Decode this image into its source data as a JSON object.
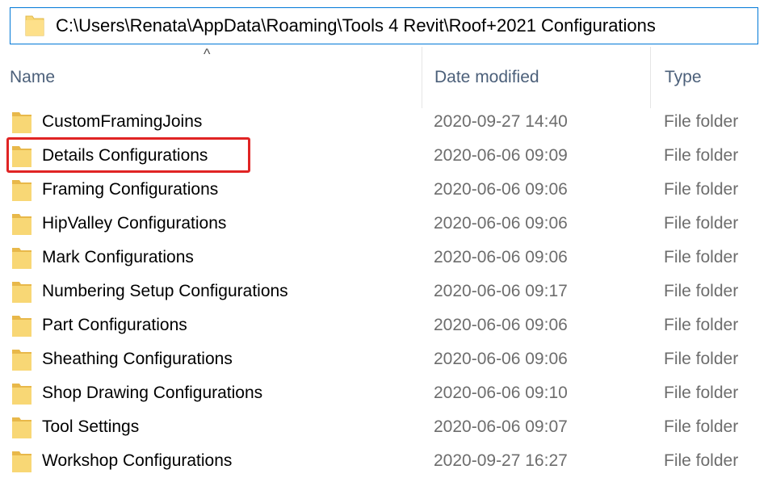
{
  "address_bar": {
    "path": "C:\\Users\\Renata\\AppData\\Roaming\\Tools 4 Revit\\Roof+2021 Configurations"
  },
  "columns": {
    "name": "Name",
    "date_modified": "Date modified",
    "type": "Type",
    "sort_indicator": "^"
  },
  "highlight_color": "#e02424",
  "folder_color": "#f8d775",
  "items": [
    {
      "name": "CustomFramingJoins",
      "date": "2020-09-27 14:40",
      "type": "File folder"
    },
    {
      "name": "Details Configurations",
      "date": "2020-06-06 09:09",
      "type": "File folder",
      "highlighted": true
    },
    {
      "name": "Framing Configurations",
      "date": "2020-06-06 09:06",
      "type": "File folder"
    },
    {
      "name": "HipValley Configurations",
      "date": "2020-06-06 09:06",
      "type": "File folder"
    },
    {
      "name": "Mark Configurations",
      "date": "2020-06-06 09:06",
      "type": "File folder"
    },
    {
      "name": "Numbering Setup Configurations",
      "date": "2020-06-06 09:17",
      "type": "File folder"
    },
    {
      "name": "Part Configurations",
      "date": "2020-06-06 09:06",
      "type": "File folder"
    },
    {
      "name": "Sheathing Configurations",
      "date": "2020-06-06 09:06",
      "type": "File folder"
    },
    {
      "name": "Shop Drawing Configurations",
      "date": "2020-06-06 09:10",
      "type": "File folder"
    },
    {
      "name": "Tool Settings",
      "date": "2020-06-06 09:07",
      "type": "File folder"
    },
    {
      "name": "Workshop Configurations",
      "date": "2020-09-27 16:27",
      "type": "File folder"
    }
  ]
}
